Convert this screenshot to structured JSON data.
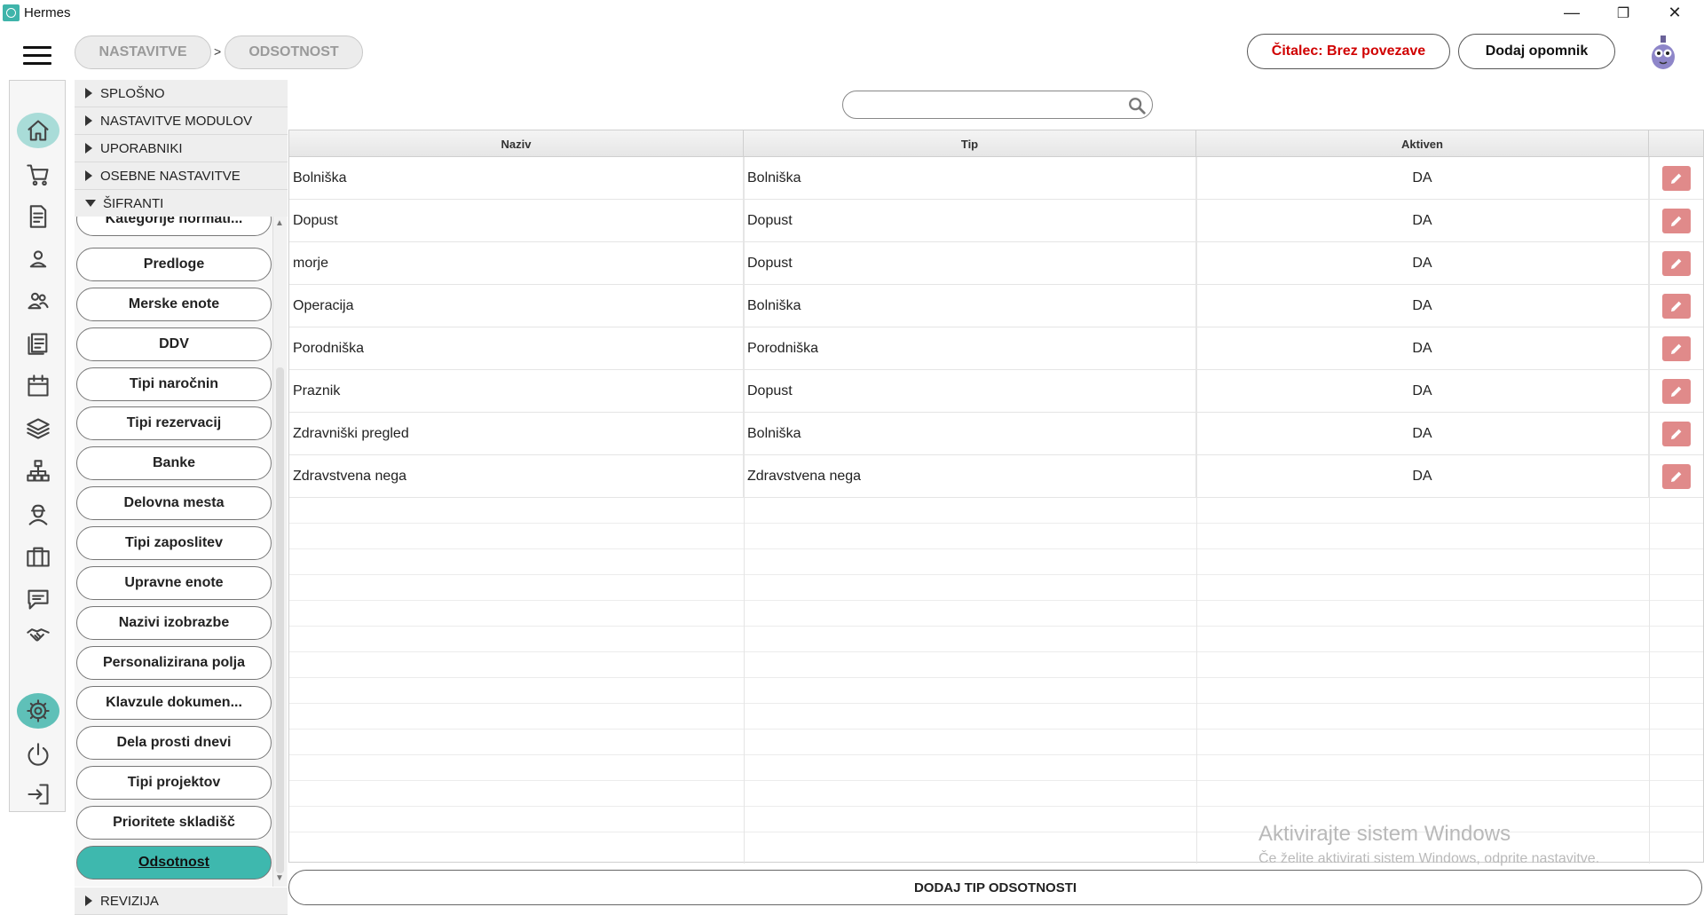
{
  "window": {
    "title": "Hermes",
    "minimize_glyph": "—",
    "restore_glyph": "❐",
    "close_glyph": "✕"
  },
  "breadcrumb": [
    "NASTAVITVE",
    "ODSOTNOST"
  ],
  "breadcrumb_separator": ">",
  "header": {
    "reader_status": "Čitalec: Brez povezave",
    "add_reminder": "Dodaj opomnik"
  },
  "rail_icons": [
    "home-icon",
    "cart-icon",
    "invoice-icon",
    "user-icon",
    "users-icon",
    "documents-icon",
    "calendar-icon",
    "layers-icon",
    "network-icon",
    "worker-icon",
    "briefcase-icon",
    "chat-icon",
    "handshake-icon",
    "gear-icon",
    "power-icon",
    "logout-icon"
  ],
  "tree": {
    "sections": [
      "SPLOŠNO",
      "NASTAVITVE MODULOV",
      "UPORABNIKI",
      "OSEBNE NASTAVITVE",
      "ŠIFRANTI"
    ],
    "footer_section": "REVIZIJA",
    "items": [
      "Kategorije normati...",
      "Predloge",
      "Merske enote",
      "DDV",
      "Tipi naročnin",
      "Tipi rezervacij",
      "Banke",
      "Delovna mesta",
      "Tipi zaposlitev",
      "Upravne enote",
      "Nazivi izobrazbe",
      "Personalizirana polja",
      "Klavzule dokumen...",
      "Dela prosti dnevi",
      "Tipi projektov",
      "Prioritete skladišč",
      "Odsotnost"
    ],
    "active_item": "Odsotnost"
  },
  "search": {
    "value": "",
    "placeholder": ""
  },
  "table": {
    "columns": [
      "Naziv",
      "Tip",
      "Aktiven",
      ""
    ],
    "rows": [
      {
        "naziv": "Bolniška",
        "tip": "Bolniška",
        "aktiven": "DA"
      },
      {
        "naziv": "Dopust",
        "tip": "Dopust",
        "aktiven": "DA"
      },
      {
        "naziv": "morje",
        "tip": "Dopust",
        "aktiven": "DA"
      },
      {
        "naziv": "Operacija",
        "tip": "Bolniška",
        "aktiven": "DA"
      },
      {
        "naziv": "Porodniška",
        "tip": "Porodniška",
        "aktiven": "DA"
      },
      {
        "naziv": "Praznik",
        "tip": "Dopust",
        "aktiven": "DA"
      },
      {
        "naziv": "Zdravniški pregled",
        "tip": "Bolniška",
        "aktiven": "DA"
      },
      {
        "naziv": "Zdravstvena nega",
        "tip": "Zdravstvena nega",
        "aktiven": "DA"
      }
    ]
  },
  "watermark": {
    "title": "Aktivirajte sistem Windows",
    "subtitle": "Če želite aktivirati sistem Windows, odprite nastavitve."
  },
  "footer": {
    "add_button": "DODAJ TIP ODSOTNOSTI"
  },
  "colors": {
    "accent": "#3eb8ae",
    "accent_light": "#a9dcd8",
    "edit_button": "#e08a8a",
    "reader_status": "#d00000"
  }
}
